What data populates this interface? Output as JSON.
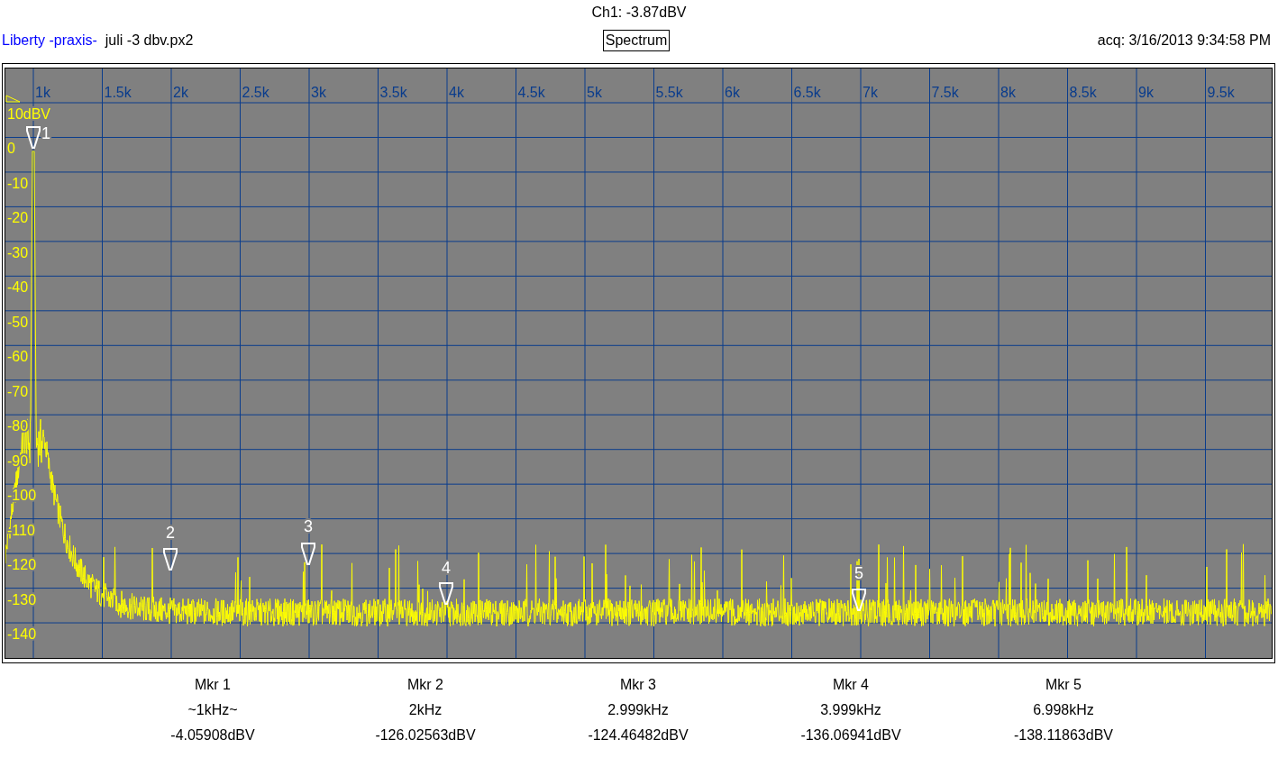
{
  "header": {
    "channel_reading": "Ch1: -3.87dBV",
    "brand": "Liberty -praxis-",
    "file_name": "juli -3 dbv.px2",
    "view_title": "Spectrum",
    "acquired": "acq: 3/16/2013 9:34:58 PM"
  },
  "plot": {
    "x_tick_labels": [
      "1k",
      "1.5k",
      "2k",
      "2.5k",
      "3k",
      "3.5k",
      "4k",
      "4.5k",
      "5k",
      "5.5k",
      "6k",
      "6.5k",
      "7k",
      "7.5k",
      "8k",
      "8.5k",
      "9k",
      "9.5k"
    ],
    "y_tick_labels": [
      "10dBV",
      "0",
      "-10",
      "-20",
      "-30",
      "-40",
      "-50",
      "-60",
      "-70",
      "-80",
      "-90",
      "-100",
      "-110",
      "-120",
      "-130",
      "-140"
    ],
    "markers": [
      {
        "label": "1"
      },
      {
        "label": "2"
      },
      {
        "label": "3"
      },
      {
        "label": "4"
      },
      {
        "label": "5"
      }
    ]
  },
  "readouts": [
    {
      "name": "Mkr 1",
      "frequency": "~1kHz~",
      "level": "-4.05908dBV"
    },
    {
      "name": "Mkr 2",
      "frequency": "2kHz",
      "level": "-126.02563dBV"
    },
    {
      "name": "Mkr 3",
      "frequency": "2.999kHz",
      "level": "-124.46482dBV"
    },
    {
      "name": "Mkr 4",
      "frequency": "3.999kHz",
      "level": "-136.06941dBV"
    },
    {
      "name": "Mkr 5",
      "frequency": "6.998kHz",
      "level": "-138.11863dBV"
    }
  ]
}
